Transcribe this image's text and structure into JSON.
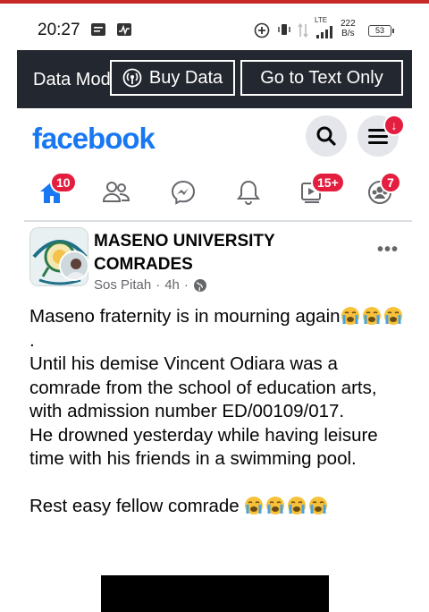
{
  "status_bar": {
    "time": "20:27",
    "network": "LTE",
    "speed_value": "222",
    "speed_unit": "B/s",
    "battery": "53"
  },
  "data_bar": {
    "label": "Data Mode",
    "buy_data": "Buy Data",
    "text_only": "Go to Text Only"
  },
  "header": {
    "logo": "facebook",
    "menu_badge": "↓"
  },
  "nav": {
    "home_badge": "10",
    "video_badge": "15+",
    "notifications_badge": "7"
  },
  "post": {
    "group_name": "MASENO UNIVERSITY COMRADES",
    "author": "Sos Pitah",
    "time": "4h",
    "separator": "·",
    "paragraphs": [
      "Maseno fraternity is in mourning again",
      "Until his demise Vincent Odiara was a comrade from the school of education arts, with admission number ED/00109/017.",
      "He drowned yesterday while having leisure time with his friends in a swimming pool.",
      "Rest easy fellow comrade"
    ],
    "line1_suffix": "."
  },
  "colors": {
    "brand": "#1877f2",
    "badge": "#e41e3f",
    "data_bar_bg": "#23272f"
  }
}
